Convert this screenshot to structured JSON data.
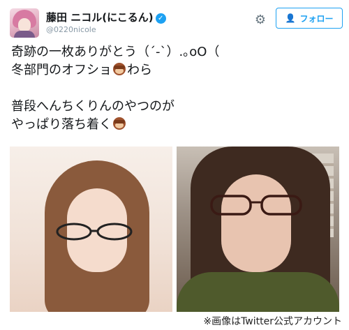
{
  "header": {
    "display_name": "藤田 ニコル(にこるん)",
    "verified_icon": "verified-badge-icon",
    "handle": "@0220nicole",
    "settings_icon": "gear-icon",
    "follow_label": "フォロー",
    "follow_icon": "person-plus-icon"
  },
  "tweet": {
    "line1": "奇跡の一枚ありがとう（´-`）.｡oO（",
    "line2_before": "冬部門のオフショ",
    "line2_after": "わら",
    "line3": "普段へんちくりんのやつのが",
    "line4": "やっぱり落ち着く",
    "emoji_name": "see-no-evil-monkey-emoji"
  },
  "photos": {
    "count": 2
  },
  "caption": "※画像はTwitter公式アカウント",
  "colors": {
    "accent": "#1da1f2",
    "text": "#14171a",
    "muted": "#8899a6"
  }
}
